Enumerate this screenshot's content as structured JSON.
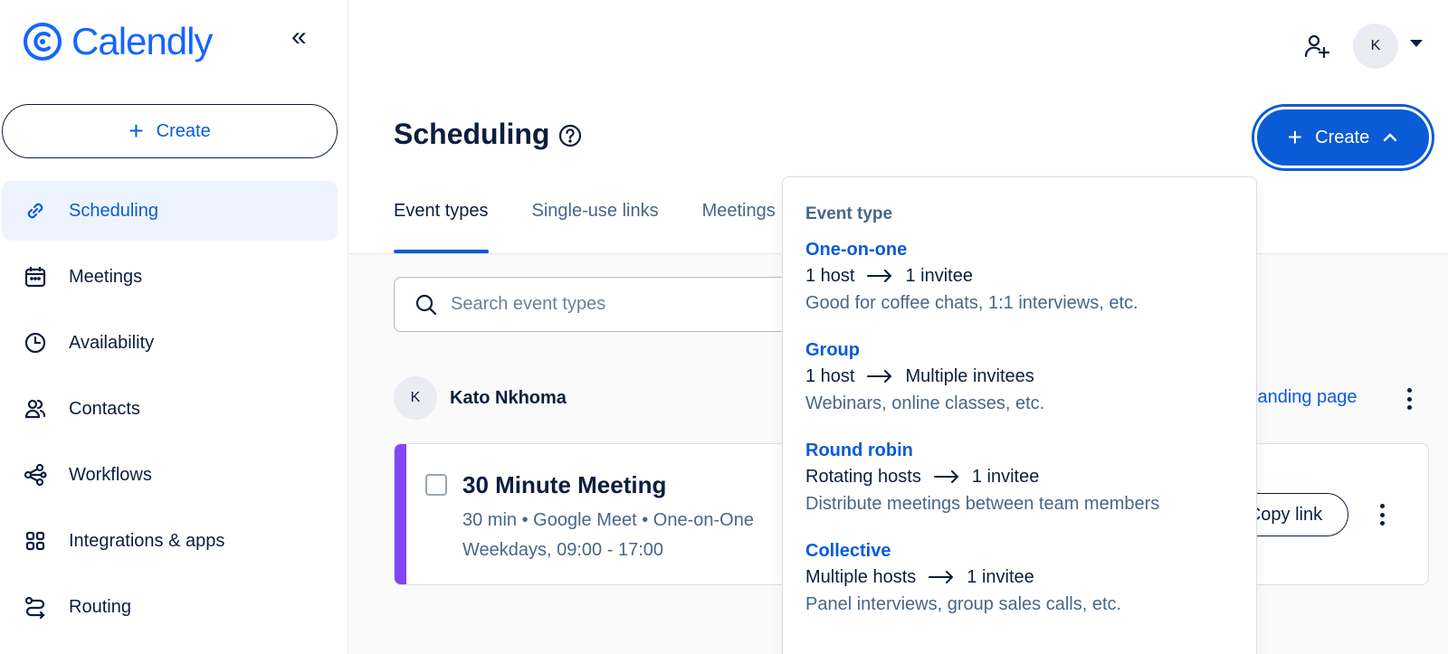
{
  "brand": {
    "name": "Calendly",
    "accent": "#0a5bd8"
  },
  "sidebar": {
    "create_label": "Create",
    "items": [
      {
        "label": "Scheduling",
        "icon": "link-icon",
        "active": true
      },
      {
        "label": "Meetings",
        "icon": "calendar-icon"
      },
      {
        "label": "Availability",
        "icon": "clock-icon"
      },
      {
        "label": "Contacts",
        "icon": "contacts-icon"
      },
      {
        "label": "Workflows",
        "icon": "workflows-icon"
      },
      {
        "label": "Integrations & apps",
        "icon": "grid-icon"
      },
      {
        "label": "Routing",
        "icon": "routing-icon"
      }
    ]
  },
  "header": {
    "avatar_initial": "K"
  },
  "page": {
    "title": "Scheduling",
    "create_label": "Create",
    "tabs": [
      "Event types",
      "Single-use links",
      "Meetings"
    ]
  },
  "search": {
    "placeholder": "Search event types"
  },
  "owner": {
    "initial": "K",
    "name": "Kato Nkhoma",
    "landing_link": "landing page"
  },
  "event_card": {
    "title": "30 Minute Meeting",
    "meta": "30 min • Google Meet • One-on-One",
    "hours": "Weekdays, 09:00 - 17:00",
    "copy_label": "Copy link",
    "color": "#8247f5"
  },
  "dropdown": {
    "heading": "Event type",
    "options": [
      {
        "name": "One-on-one",
        "hosts": "1 host",
        "invitees": "1 invitee",
        "desc": "Good for coffee chats, 1:1 interviews, etc."
      },
      {
        "name": "Group",
        "hosts": "1 host",
        "invitees": "Multiple invitees",
        "desc": "Webinars, online classes, etc."
      },
      {
        "name": "Round robin",
        "hosts": "Rotating hosts",
        "invitees": "1 invitee",
        "desc": "Distribute meetings between team members"
      },
      {
        "name": "Collective",
        "hosts": "Multiple hosts",
        "invitees": "1 invitee",
        "desc": "Panel interviews, group sales calls, etc."
      }
    ]
  }
}
